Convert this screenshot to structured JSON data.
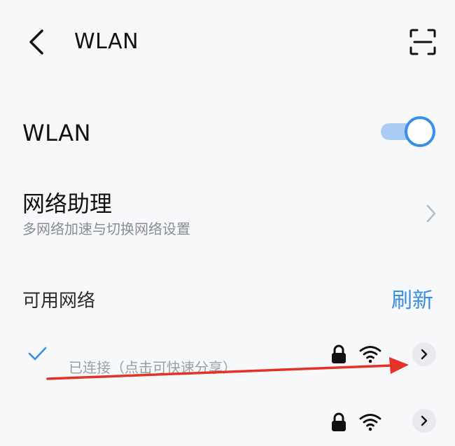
{
  "colors": {
    "accent": "#3b8ee8",
    "accent_light": "#aacdf3",
    "annotation": "#e53127"
  },
  "header": {
    "title": "WLAN",
    "back_icon": "chevron-left-icon",
    "scan_icon": "scan-icon"
  },
  "wlan_toggle": {
    "label": "WLAN",
    "enabled": true
  },
  "assistant": {
    "title": "网络助理",
    "subtitle": "多网络加速与切换网络设置"
  },
  "available": {
    "label": "可用网络",
    "refresh": "刷新",
    "networks": [
      {
        "status": "已连接（点击可快速分享）",
        "connected": true,
        "secured": true
      },
      {
        "status": "",
        "connected": false,
        "secured": true
      }
    ]
  }
}
